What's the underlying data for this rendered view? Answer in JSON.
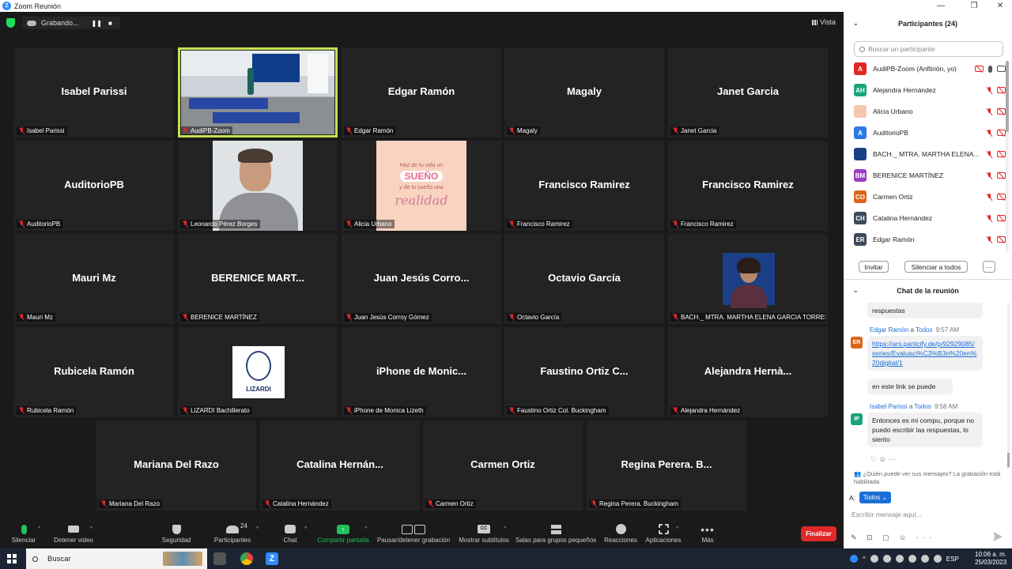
{
  "window": {
    "title": "Zoom Reunión"
  },
  "recording": {
    "label": "Grabando...",
    "pause_icon": "❚❚",
    "stop_icon": "■"
  },
  "view": {
    "label": "Vista"
  },
  "tiles": [
    {
      "name": "Isabel Parissi",
      "label": "Isabel Parissi",
      "type": "name"
    },
    {
      "name": "",
      "label": "AudiPB-Zoom",
      "type": "room",
      "active": true
    },
    {
      "name": "Edgar Ramón",
      "label": "Edgar Ramón",
      "type": "name"
    },
    {
      "name": "Magaly",
      "label": "Magaly",
      "type": "name"
    },
    {
      "name": "Janet Garcia",
      "label": "Janet Garcia",
      "type": "name"
    },
    {
      "name": "AuditorioPB",
      "label": "AuditorioPB",
      "type": "name"
    },
    {
      "name": "",
      "label": "Leonardo Pérez Borges",
      "type": "man"
    },
    {
      "name": "",
      "label": "Alicia Urbano",
      "type": "suen"
    },
    {
      "name": "Francisco Ramirez",
      "label": "Francisco Ramirez",
      "type": "name"
    },
    {
      "name": "Francisco Ramirez",
      "label": "Francisco Ramirez",
      "type": "name"
    },
    {
      "name": "Mauri Mz",
      "label": "Mauri Mz",
      "type": "name"
    },
    {
      "name": "BERENICE MART...",
      "label": "BERENICE MARTÍNEZ",
      "type": "name"
    },
    {
      "name": "Juan Jesús Corro...",
      "label": "Juan Jesús Corroy Gómez",
      "type": "name"
    },
    {
      "name": "Octavio García",
      "label": "Octavio García",
      "type": "name"
    },
    {
      "name": "",
      "label": "BACH._ MTRA. MARTHA ELENA GARCIA TORRES",
      "type": "lady"
    },
    {
      "name": "Rubicela Ramón",
      "label": "Rubicela Ramón",
      "type": "name"
    },
    {
      "name": "",
      "label": "LIZARDI Bachillerato",
      "type": "lizardi"
    },
    {
      "name": "iPhone de Monic...",
      "label": "iPhone de Monica Lizeth",
      "type": "name"
    },
    {
      "name": "Faustino Ortiz C...",
      "label": "Faustino Ortiz Col. Buckingham",
      "type": "name"
    },
    {
      "name": "Alejandra Hernà...",
      "label": "Alejandra Hernández",
      "type": "name"
    },
    {
      "name": "Mariana Del Razo",
      "label": "Mariana Del Razo",
      "type": "name"
    },
    {
      "name": "Catalina Hernán...",
      "label": "Catalina Hernández",
      "type": "name"
    },
    {
      "name": "Carmen Ortiz",
      "label": "Carmen Ortiz",
      "type": "name"
    },
    {
      "name": "Regina Perera. B...",
      "label": "Regina Perera. Buckingham",
      "type": "name"
    }
  ],
  "thumbs": {
    "suen_l1": "Haz de tu vida un",
    "suen_l2": "SUEÑO",
    "suen_l3": "y de tu sueño una",
    "suen_l4": "realidad",
    "lizardi": "LIZARDI"
  },
  "toolbar": {
    "mute": "Silenciar",
    "video": "Detener video",
    "security": "Seguridad",
    "participants": "Participantes",
    "participants_count": "24",
    "chat": "Chat",
    "share": "Compartir pantalla",
    "record": "Pausar/detener grabación",
    "cc_icon": "CC",
    "subtitles": "Mostrar subtítulos",
    "rooms": "Salas para grupos pequeños",
    "reactions": "Reacciones",
    "apps": "Aplicaciones",
    "more": "Más",
    "end": "Finalizar"
  },
  "participants_panel": {
    "title": "Participantes (24)",
    "search_placeholder": "Buscar un participante",
    "list": [
      {
        "initials": "A",
        "name": "AudiPB-Zoom (Anfitrión, yo)",
        "color": "#e02828",
        "host": true
      },
      {
        "initials": "AH",
        "name": "Alejandra Hernández",
        "color": "#18a57b"
      },
      {
        "initials": "",
        "name": "Alicia Urbano",
        "color": "#f7c6ae"
      },
      {
        "initials": "A",
        "name": "AuditorioPB",
        "color": "#2d7be0"
      },
      {
        "initials": "",
        "name": "BACH._ MTRA. MARTHA ELENA...",
        "color": "#1a3f86"
      },
      {
        "initials": "BM",
        "name": "BERENICE MARTÍNEZ",
        "color": "#9b3fbf"
      },
      {
        "initials": "CO",
        "name": "Carmen Ortiz",
        "color": "#d9651b"
      },
      {
        "initials": "CH",
        "name": "Catalina Hernández",
        "color": "#3c4a5a"
      },
      {
        "initials": "ER",
        "name": "Edgar Ramón",
        "color": "#3c4a5a"
      }
    ],
    "invite": "Invitar",
    "mute_all": "Silenciar a todos",
    "more": "···"
  },
  "chat_panel": {
    "title": "Chat de la reunión",
    "msg0": "respuestas",
    "msg1_sender": "Edgar Ramón",
    "msg1_to": "a",
    "msg1_target": "Todos",
    "msg1_time": "9:57 AM",
    "msg1_avatar": "ER",
    "msg1_link": "https://ars.particify.de/p/92929085/series/Evaluaci%C3%B3n%20en%20digital/1",
    "msg1_text2": "en este link se puede",
    "msg2_sender": "Isabel Parissi",
    "msg2_to": "a",
    "msg2_target": "Todos",
    "msg2_time": "9:58 AM",
    "msg2_avatar": "IP",
    "msg2_text": "Entonces es mi compu, porque no puedo escribir las respuestas, lo siento",
    "reactions": "♡ ☺ ···",
    "note": "¿Quién puede ver sus mensajes? La grabación está habilitada",
    "to_label": "A:",
    "to_value": "Todos ⌄",
    "input_placeholder": "Escribir mensaje aquí...",
    "tools": "✎ ⊡ ▢ ☺ ···",
    "colors": {
      "er": "#d9651b",
      "ip": "#18a57b"
    }
  },
  "taskbar": {
    "search": "Buscar",
    "lang": "ESP",
    "time": "10:06 a. m.",
    "date": "25/03/2023"
  }
}
